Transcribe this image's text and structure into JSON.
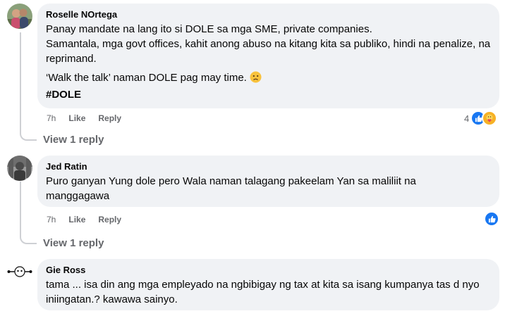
{
  "comments": [
    {
      "author": "Roselle NOrtega",
      "lines": [
        "Panay mandate na lang ito si DOLE sa mga SME, private companies.",
        "Samantala, mga govt offices, kahit anong abuso na kitang kita sa publiko, hindi na penalize, na reprimand.",
        "‘Walk the talk’ naman DOLE pag may time.",
        "#DOLE"
      ],
      "time": "7h",
      "like_label": "Like",
      "reply_label": "Reply",
      "reaction_count": "4",
      "reactions": [
        "like-icon",
        "care-icon"
      ],
      "view_replies": "View 1 reply"
    },
    {
      "author": "Jed Ratin",
      "lines": [
        "Puro ganyan Yung dole pero Wala naman talagang pakeelam Yan sa maliliit na manggagawa"
      ],
      "time": "7h",
      "like_label": "Like",
      "reply_label": "Reply",
      "reactions": [
        "like-icon"
      ],
      "view_replies": "View 1 reply"
    },
    {
      "author": "Gie Ross",
      "lines": [
        "tama ... isa din ang mga empleyado na ngbibigay ng tax at kita sa isang kumpanya tas d nyo iniingatan.? kawawa sainyo."
      ]
    }
  ],
  "colors": {
    "bubble": "#f0f2f5",
    "meta_text": "#65676b",
    "like_blue": "#1877f2",
    "care_yellow": "#f7b125"
  }
}
